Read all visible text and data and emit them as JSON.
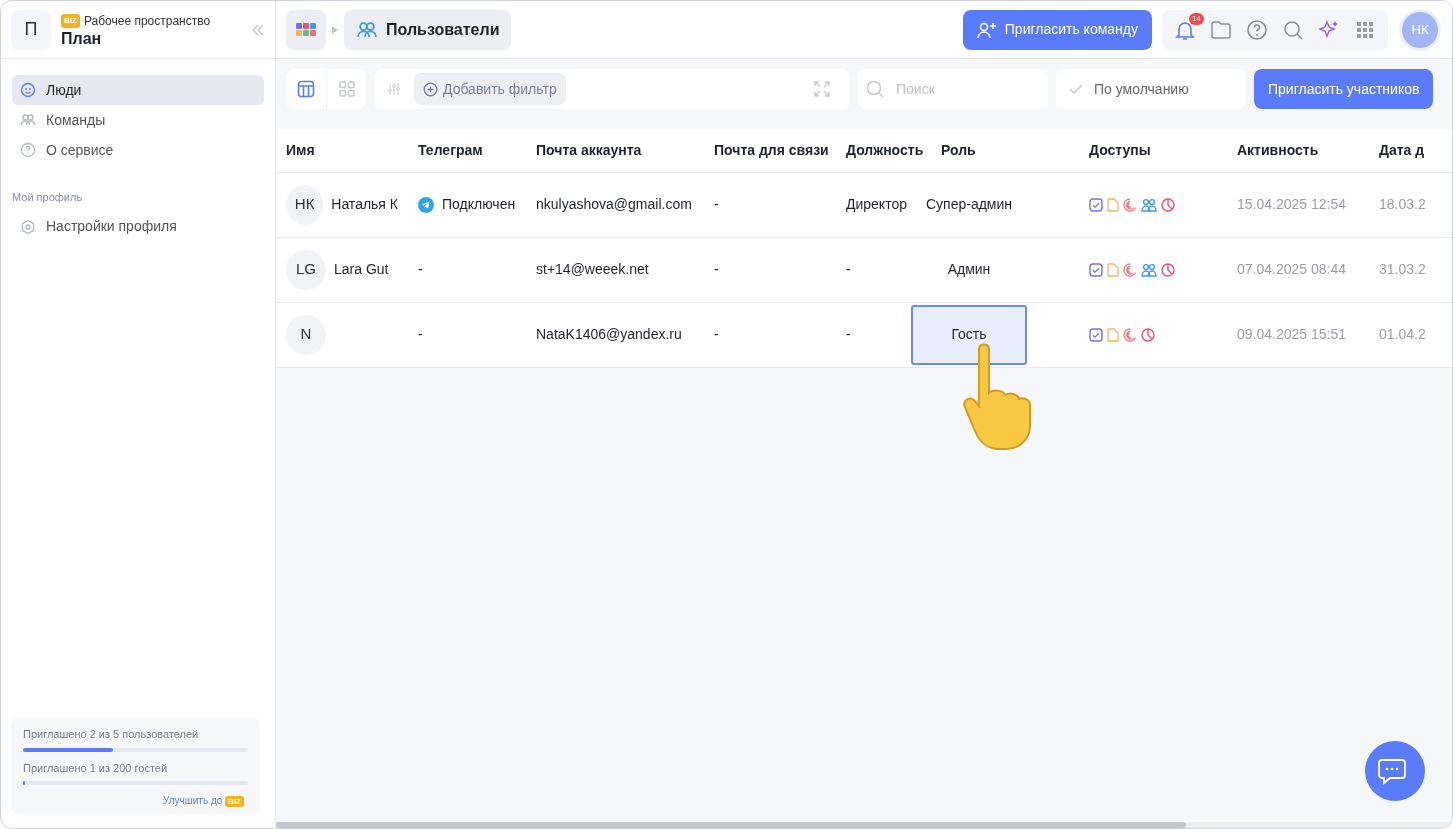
{
  "sidebar": {
    "workspace": {
      "initial": "П",
      "badge": "BIZ",
      "label": "Рабочее пространство",
      "name": "План"
    },
    "nav": [
      {
        "label": "Люди",
        "kind": "smile",
        "selected": true
      },
      {
        "label": "Команды",
        "kind": "team",
        "selected": false
      },
      {
        "label": "О сервисе",
        "kind": "help",
        "selected": false
      }
    ],
    "section_title": "Мой профиль",
    "profile_items": [
      {
        "label": "Настройки профиля",
        "kind": "gear",
        "selected": false
      }
    ],
    "limits": [
      {
        "text": "Приглашено 2 из 5 пользователей",
        "level": 0.4
      },
      {
        "text": "Приглашено 1 из 200 гостей",
        "level": 0.005
      }
    ],
    "upgrade": {
      "text": "Улучшить до",
      "badge": "BIZ"
    }
  },
  "topbar": {
    "breadcrumb": "Пользователи",
    "invite_team": "Пригласить команду",
    "notifications": "14",
    "avatar": "НК"
  },
  "toolbar": {
    "views": [
      {
        "kind": "table",
        "selected": true
      },
      {
        "kind": "grid",
        "selected": false
      }
    ],
    "add_filter": "Добавить фильтр",
    "search": {
      "placeholder": "Поиск"
    },
    "sort": "По умолчанию",
    "invite_members": "Пригласить участников"
  },
  "table": {
    "columns": [
      "Имя",
      "Телеграм",
      "Почта аккаунта",
      "Почта для связи",
      "Должность",
      "Роль",
      "Доступы",
      "Активность",
      "Дата д"
    ],
    "rows": [
      {
        "avatar": "НК",
        "name": "Наталья К",
        "telegram": {
          "text": "Подключен",
          "connected": true
        },
        "email": "nkulyashova@gmail.com",
        "contact_email": "-",
        "position": "Директор",
        "role": {
          "text": "Супер-админ",
          "selected": false
        },
        "access": [
          {
            "kind": "tasks"
          },
          {
            "kind": "docs"
          },
          {
            "kind": "crm"
          },
          {
            "kind": "teams"
          },
          {
            "kind": "analytics"
          }
        ],
        "activity": "15.04.2025 12:54",
        "date": "18.03.2"
      },
      {
        "avatar": "LG",
        "name": "Lara Gut",
        "telegram": {
          "text": "-",
          "connected": false
        },
        "email": "st+14@weeek.net",
        "contact_email": "-",
        "position": "-",
        "role": {
          "text": "Админ",
          "selected": false
        },
        "access": [
          {
            "kind": "tasks"
          },
          {
            "kind": "docs"
          },
          {
            "kind": "crm"
          },
          {
            "kind": "teams"
          },
          {
            "kind": "analytics"
          }
        ],
        "activity": "07.04.2025 08:44",
        "date": "31.03.2"
      },
      {
        "avatar": "N",
        "telegram": {
          "text": "-",
          "connected": false
        },
        "email": "NataK1406@yandex.ru",
        "contact_email": "-",
        "position": "-",
        "role": {
          "text": "Гость",
          "selected": true
        },
        "access": [
          {
            "kind": "tasks"
          },
          {
            "kind": "docs"
          },
          {
            "kind": "crm"
          },
          {
            "kind": "analytics"
          }
        ],
        "activity": "09.04.2025 15:51",
        "date": "01.04.2"
      }
    ]
  }
}
